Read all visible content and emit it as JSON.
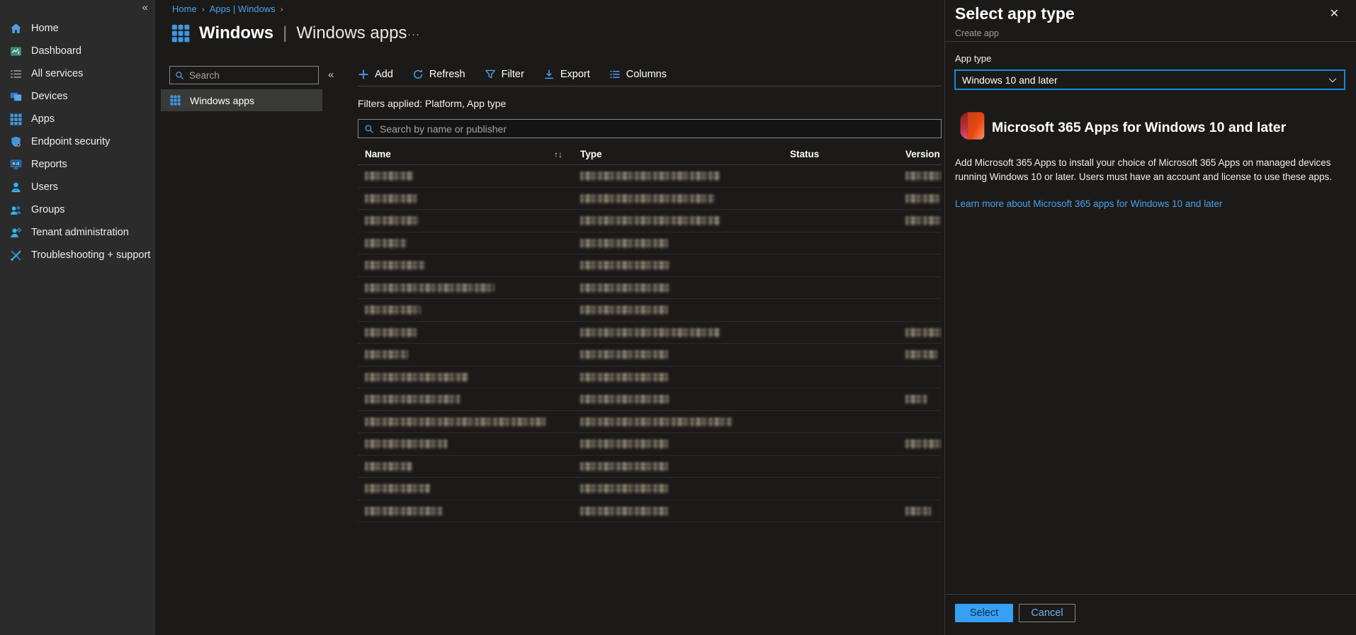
{
  "colors": {
    "accent_blue": "#4da0e8",
    "breadcrumb_link": "#4ba0e8",
    "sidebar_bg": "#2b2b2b",
    "content_bg": "#1b1a19",
    "selected_row_bg": "#3a3a39",
    "dropdown_border": "#1489d8",
    "primary_button_bg": "#35a0f4",
    "cancel_button_text": "#6cb5f0"
  },
  "sidebar": {
    "collapse_glyph": "«",
    "items": [
      {
        "label": "Home",
        "icon": "home-icon"
      },
      {
        "label": "Dashboard",
        "icon": "dashboard-icon"
      },
      {
        "label": "All services",
        "icon": "all-services-icon"
      },
      {
        "label": "Devices",
        "icon": "devices-icon"
      },
      {
        "label": "Apps",
        "icon": "apps-icon"
      },
      {
        "label": "Endpoint security",
        "icon": "endpoint-security-icon"
      },
      {
        "label": "Reports",
        "icon": "reports-icon"
      },
      {
        "label": "Users",
        "icon": "users-icon"
      },
      {
        "label": "Groups",
        "icon": "groups-icon"
      },
      {
        "label": "Tenant administration",
        "icon": "tenant-admin-icon"
      },
      {
        "label": "Troubleshooting + support",
        "icon": "troubleshooting-icon"
      }
    ]
  },
  "breadcrumb": {
    "items": [
      "Home",
      "Apps | Windows"
    ],
    "separator": "›"
  },
  "header": {
    "icon": "apps-grid-icon",
    "title_primary": "Windows",
    "title_divider": "|",
    "title_secondary": "Windows apps",
    "more_glyph": "···"
  },
  "list_panel": {
    "search_placeholder": "Search",
    "collapse_glyph": "«",
    "selected_item": {
      "label": "Windows apps",
      "icon": "apps-grid-icon"
    }
  },
  "toolbar": {
    "items": [
      {
        "label": "Add",
        "icon": "add-icon"
      },
      {
        "label": "Refresh",
        "icon": "refresh-icon"
      },
      {
        "label": "Filter",
        "icon": "filter-icon"
      },
      {
        "label": "Export",
        "icon": "export-icon"
      },
      {
        "label": "Columns",
        "icon": "columns-icon"
      }
    ]
  },
  "filters_bar": {
    "text": "Filters applied: Platform, App type"
  },
  "apps_table": {
    "search_placeholder": "Search by name or publisher",
    "columns": [
      "Name",
      "Type",
      "Status",
      "Version"
    ],
    "sort_glyph": "↑↓",
    "rows_note": "row content redacted/blurred in source; widths are blur extents in px",
    "rows": [
      {
        "name_w": 68,
        "type_w": 197,
        "version_w": 57
      },
      {
        "name_w": 74,
        "type_w": 190,
        "version_w": 49
      },
      {
        "name_w": 76,
        "type_w": 197,
        "version_w": 51
      },
      {
        "name_w": 59,
        "type_w": 124,
        "version_w": 0
      },
      {
        "name_w": 85,
        "type_w": 126,
        "version_w": 0
      },
      {
        "name_w": 183,
        "type_w": 126,
        "version_w": 0
      },
      {
        "name_w": 79,
        "type_w": 124,
        "version_w": 0
      },
      {
        "name_w": 73,
        "type_w": 197,
        "version_w": 60
      },
      {
        "name_w": 61,
        "type_w": 124,
        "version_w": 45
      },
      {
        "name_w": 146,
        "type_w": 124,
        "version_w": 0
      },
      {
        "name_w": 134,
        "type_w": 126,
        "version_w": 30
      },
      {
        "name_w": 256,
        "type_w": 215,
        "version_w": 0
      },
      {
        "name_w": 116,
        "type_w": 124,
        "version_w": 57
      },
      {
        "name_w": 67,
        "type_w": 124,
        "version_w": 0
      },
      {
        "name_w": 92,
        "type_w": 124,
        "version_w": 0
      },
      {
        "name_w": 110,
        "type_w": 124,
        "version_w": 36
      }
    ]
  },
  "flyout": {
    "title": "Select app type",
    "close_glyph": "✕",
    "subtitle": "Create app",
    "app_type": {
      "label": "App type",
      "value": "Windows 10 and later"
    },
    "app_info": {
      "icon": "m365-icon",
      "heading": "Microsoft 365 Apps for Windows 10 and later",
      "description": "Add Microsoft 365 Apps to install your choice of Microsoft 365 Apps on managed devices running Windows 10 or later. Users must have an account and license to use these apps.",
      "link": "Learn more about Microsoft 365 apps for Windows 10 and later"
    },
    "footer": {
      "select_label": "Select",
      "cancel_label": "Cancel"
    }
  }
}
